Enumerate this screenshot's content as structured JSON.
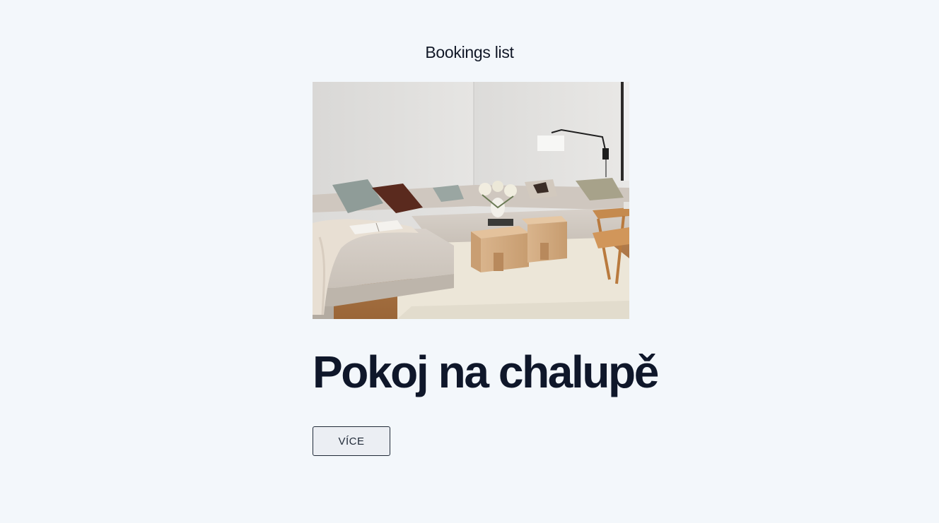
{
  "header": {
    "title": "Bookings list"
  },
  "booking": {
    "image_icon": "living-room-photo",
    "title": "Pokoj na chalupě",
    "more_label": "VÍCE"
  },
  "colors": {
    "background": "#f3f7fb",
    "text": "#0f172a",
    "button_bg": "#ebeef3",
    "button_border": "#1f2937"
  }
}
